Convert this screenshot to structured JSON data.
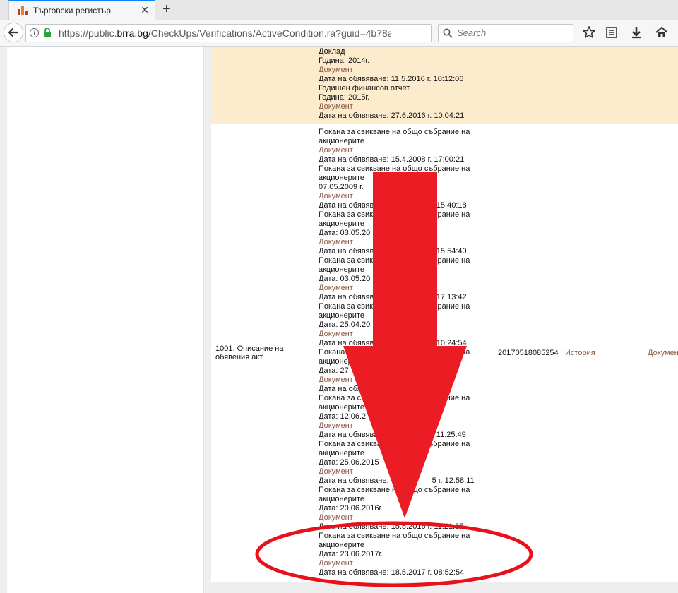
{
  "browser": {
    "tab_title": "Търговски регистър",
    "url_prefix": "https://public.",
    "url_domain": "brra.bg",
    "url_rest": "/CheckUps/Verifications/ActiveCondition.ra?guid=4b78a",
    "search_placeholder": "Search",
    "info_glyph": "i",
    "close_glyph": "✕",
    "new_tab_glyph": "+"
  },
  "top_block": {
    "lines": [
      {
        "text": "Доклад",
        "type": "text"
      },
      {
        "text": "Година: 2014г.",
        "type": "text"
      },
      {
        "text": "Документ",
        "type": "link"
      },
      {
        "text": "Дата на обявяване: 11.5.2016 г. 10:12:06",
        "type": "text"
      },
      {
        "text": "Годишен финансов отчет",
        "type": "text"
      },
      {
        "text": "Година: 2015г.",
        "type": "text"
      },
      {
        "text": "Документ",
        "type": "link"
      },
      {
        "text": "Дата на обявяване: 27.6.2016 г. 10:04:21",
        "type": "text"
      }
    ]
  },
  "main_row": {
    "description": "1001.  Описание на обявения акт",
    "registration_number": "20170518085254",
    "history_label": "История",
    "document_label": "Документ",
    "lines": [
      {
        "text": "Покана за свикване на общо събрание на",
        "type": "text"
      },
      {
        "text": "акционерите",
        "type": "text"
      },
      {
        "text": "Документ",
        "type": "link"
      },
      {
        "text": "Дата на обявяване: 15.4.2008 г. 17:00:21",
        "type": "text"
      },
      {
        "text": "Покана за свикване на общо събрание на",
        "type": "text"
      },
      {
        "text": "акционерите",
        "type": "text"
      },
      {
        "text": "07.05.2009 г.",
        "type": "text"
      },
      {
        "text": "Документ",
        "type": "link"
      },
      {
        "text": "Дата на обявяване:                      15:40:18",
        "type": "text"
      },
      {
        "text": "Покана за свикване на общо събрание на",
        "type": "text"
      },
      {
        "text": "акционерите",
        "type": "text"
      },
      {
        "text": "Дата: 03.05.20",
        "type": "text"
      },
      {
        "text": "Документ",
        "type": "link"
      },
      {
        "text": "Дата на обявяване:                      15:54:40",
        "type": "text"
      },
      {
        "text": "Покана за свикване на общо събрание на",
        "type": "text"
      },
      {
        "text": "акционерите",
        "type": "text"
      },
      {
        "text": "Дата: 03.05.20",
        "type": "text"
      },
      {
        "text": "Документ",
        "type": "link"
      },
      {
        "text": "Дата на обявяване:                      17:13:42",
        "type": "text"
      },
      {
        "text": "Покана за свикване на общо събрание на",
        "type": "text"
      },
      {
        "text": "акционерите",
        "type": "text"
      },
      {
        "text": "Дата: 25.04.20",
        "type": "text"
      },
      {
        "text": "Документ",
        "type": "link"
      },
      {
        "text": "Дата на обявяване:                      10:24:54",
        "type": "text"
      },
      {
        "text": "Покана за свикване на общо събрание на",
        "type": "text"
      },
      {
        "text": "акционерите",
        "type": "text"
      },
      {
        "text": "Дата: 27",
        "type": "text"
      },
      {
        "text": "Документ",
        "type": "link"
      },
      {
        "text": "Дата на обявяване:                        :10",
        "type": "text"
      },
      {
        "text": "Покана за свикване на общо събрание на",
        "type": "text"
      },
      {
        "text": "акционерите",
        "type": "text"
      },
      {
        "text": "Дата: 12.06.2",
        "type": "text"
      },
      {
        "text": "Документ",
        "type": "link"
      },
      {
        "text": "Дата на обявяване:                      11:25:49",
        "type": "text"
      },
      {
        "text": "Покана за свикване на общо събрание на",
        "type": "text"
      },
      {
        "text": "акционерите",
        "type": "text"
      },
      {
        "text": "Дата: 25.06.2015",
        "type": "text"
      },
      {
        "text": "Документ",
        "type": "link"
      },
      {
        "text": "Дата на обявяване:                    5 г. 12:58:11",
        "type": "text"
      },
      {
        "text": "Покана за свикване на общо събрание на",
        "type": "text"
      },
      {
        "text": "акционерите",
        "type": "text"
      },
      {
        "text": "Дата: 20.06.2016г.",
        "type": "text"
      },
      {
        "text": "Документ",
        "type": "link"
      },
      {
        "text": "Дата на обявяване: 15.5.2016 г. 11:21:07",
        "type": "text"
      },
      {
        "text": "Покана за свикване на общо събрание на",
        "type": "text"
      },
      {
        "text": "акционерите",
        "type": "text"
      },
      {
        "text": "Дата: 23.06.2017г.",
        "type": "text"
      },
      {
        "text": "Документ",
        "type": "link"
      },
      {
        "text": "Дата на обявяване: 18.5.2017 г. 08:52:54",
        "type": "text"
      }
    ]
  },
  "annotation": {
    "arrow_color": "#ec1c24",
    "ellipse_color": "#e8101a"
  }
}
